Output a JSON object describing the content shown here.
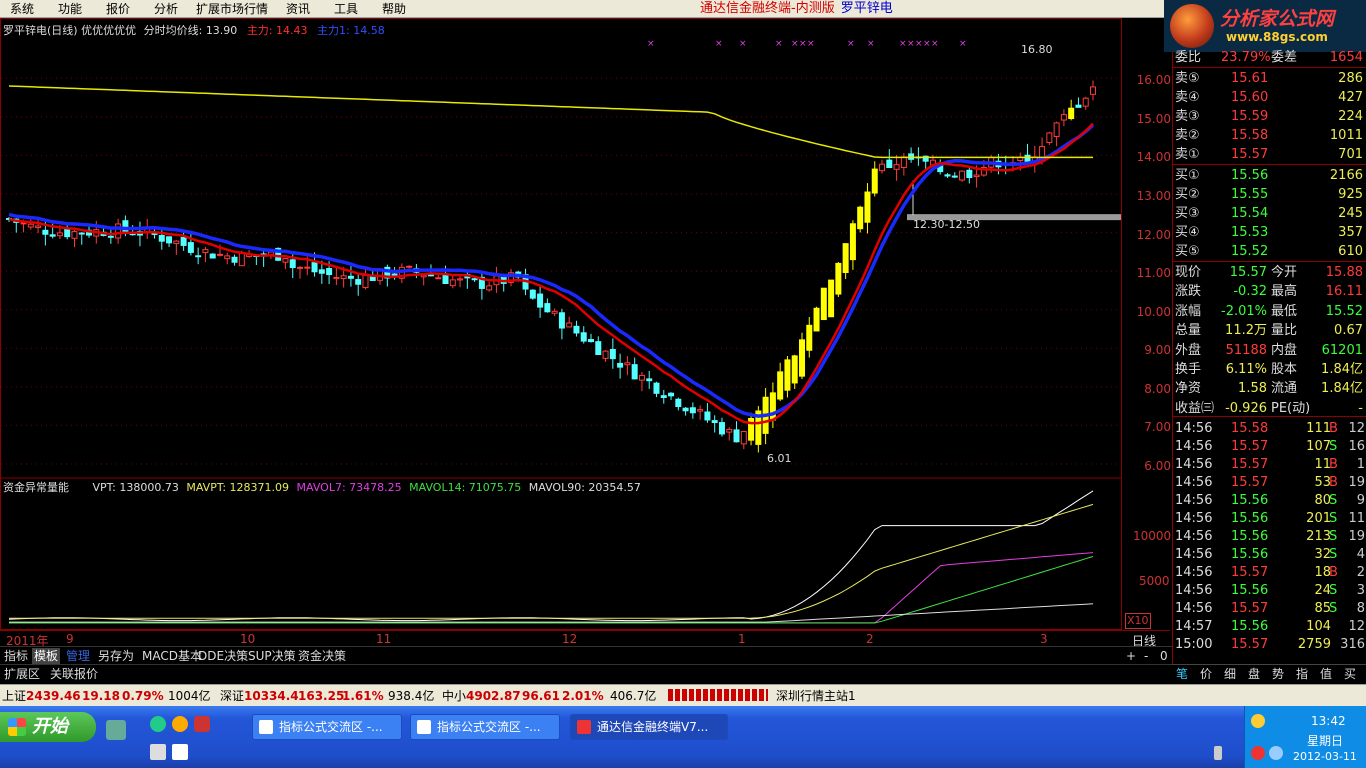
{
  "menu": [
    "系统",
    "功能",
    "报价",
    "分析",
    "扩展市场行情",
    "资讯",
    "工具",
    "帮助"
  ],
  "app_title": {
    "part1": "通达信金融终端-内测版",
    "part2": "罗平锌电"
  },
  "logo": {
    "name": "分析家公式网",
    "url": "www.88gs.com"
  },
  "chart_header": {
    "stock": "罗平锌电(日线)",
    "tags": "优优优优优",
    "avg_label": "分时均价线:",
    "avg_value": "13.90",
    "main1": "主力: 14.43",
    "main2": "主力1: 14.58"
  },
  "price_labels": {
    "high": "16.80",
    "low": "6.01",
    "band": "12.30-12.50"
  },
  "y_labels": [
    "16.00",
    "15.00",
    "14.00",
    "13.00",
    "12.00",
    "11.00",
    "10.00",
    "9.00",
    "8.00",
    "7.00",
    "6.00"
  ],
  "indicator": {
    "name": "资金异常量能",
    "vpt": "VPT: 138000.73",
    "mavpt": "MAVPT: 128371.09",
    "mavol7": "MAVOL7: 73478.25",
    "mavol14": "MAVOL14: 71075.75",
    "mavol90": "MAVOL90: 20354.57",
    "y1": "10000",
    "y2": "5000",
    "scale": "X10"
  },
  "time_axis": [
    "2011年",
    "9",
    "10",
    "11",
    "12",
    "1",
    "2",
    "3"
  ],
  "period": "日线",
  "zoom": [
    "+",
    "-",
    "0"
  ],
  "tabs": [
    "指标",
    "模板",
    "管理",
    "另存为",
    "MACD基本",
    "DDE决策",
    "SUP决策",
    "资金决策"
  ],
  "tabs2": [
    "扩展区",
    "关联报价"
  ],
  "order_book": {
    "top": {
      "label": "委比",
      "value": "23.79%",
      "label2": "委差",
      "value2": "1654"
    },
    "asks": [
      {
        "label": "卖⑤",
        "price": "15.61",
        "vol": "286"
      },
      {
        "label": "卖④",
        "price": "15.60",
        "vol": "427"
      },
      {
        "label": "卖③",
        "price": "15.59",
        "vol": "224"
      },
      {
        "label": "卖②",
        "price": "15.58",
        "vol": "1011"
      },
      {
        "label": "卖①",
        "price": "15.57",
        "vol": "701"
      }
    ],
    "bids": [
      {
        "label": "买①",
        "price": "15.56",
        "vol": "2166"
      },
      {
        "label": "买②",
        "price": "15.55",
        "vol": "925"
      },
      {
        "label": "买③",
        "price": "15.54",
        "vol": "245"
      },
      {
        "label": "买④",
        "price": "15.53",
        "vol": "357"
      },
      {
        "label": "买⑤",
        "price": "15.52",
        "vol": "610"
      }
    ]
  },
  "quote": [
    {
      "l1": "现价",
      "v1": "15.57",
      "l2": "今开",
      "v2": "15.88"
    },
    {
      "l1": "涨跌",
      "v1": "-0.32",
      "l2": "最高",
      "v2": "16.11"
    },
    {
      "l1": "涨幅",
      "v1": "-2.01%",
      "l2": "最低",
      "v2": "15.52"
    },
    {
      "l1": "总量",
      "v1": "11.2万",
      "l2": "量比",
      "v2": "0.67"
    },
    {
      "l1": "外盘",
      "v1": "51188",
      "l2": "内盘",
      "v2": "61201"
    },
    {
      "l1": "换手",
      "v1": "6.11%",
      "l2": "股本",
      "v2": "1.84亿"
    },
    {
      "l1": "净资",
      "v1": "1.58",
      "l2": "流通",
      "v2": "1.84亿"
    },
    {
      "l1": "收益㈢",
      "v1": "-0.926",
      "l2": "PE(动)",
      "v2": "-"
    }
  ],
  "ticks": [
    {
      "t": "14:56",
      "p": "15.58",
      "v": "111",
      "bs": "B",
      "n": "12"
    },
    {
      "t": "14:56",
      "p": "15.57",
      "v": "107",
      "bs": "S",
      "n": "16"
    },
    {
      "t": "14:56",
      "p": "15.57",
      "v": "11",
      "bs": "B",
      "n": "1"
    },
    {
      "t": "14:56",
      "p": "15.57",
      "v": "53",
      "bs": "B",
      "n": "19"
    },
    {
      "t": "14:56",
      "p": "15.56",
      "v": "80",
      "bs": "S",
      "n": "9"
    },
    {
      "t": "14:56",
      "p": "15.56",
      "v": "201",
      "bs": "S",
      "n": "11"
    },
    {
      "t": "14:56",
      "p": "15.56",
      "v": "213",
      "bs": "S",
      "n": "19"
    },
    {
      "t": "14:56",
      "p": "15.56",
      "v": "32",
      "bs": "S",
      "n": "4"
    },
    {
      "t": "14:56",
      "p": "15.57",
      "v": "18",
      "bs": "B",
      "n": "2"
    },
    {
      "t": "14:56",
      "p": "15.56",
      "v": "24",
      "bs": "S",
      "n": "3"
    },
    {
      "t": "14:56",
      "p": "15.57",
      "v": "85",
      "bs": "S",
      "n": "8"
    },
    {
      "t": "14:57",
      "p": "15.56",
      "v": "104",
      "bs": "",
      "n": "12"
    },
    {
      "t": "15:00",
      "p": "15.57",
      "v": "2759",
      "bs": "",
      "n": "316"
    }
  ],
  "right_tabs": [
    "笔",
    "价",
    "细",
    "盘",
    "势",
    "指",
    "值",
    "买"
  ],
  "status": {
    "sh": {
      "label": "上证",
      "val": "2439.46",
      "chg": "19.18",
      "pct": "0.79%",
      "amt": "1004亿"
    },
    "sz": {
      "label": "深证",
      "val": "10334.4",
      "chg": "163.25",
      "pct": "1.61%",
      "amt": "938.4亿"
    },
    "zx": {
      "label": "中小",
      "val": "4902.87",
      "chg": "96.61",
      "pct": "2.01%",
      "amt": "406.7亿"
    },
    "server": "深圳行情主站1"
  },
  "taskbar": {
    "start": "开始",
    "tasks": [
      "指标公式交流区 -...",
      "指标公式交流区 -...",
      "通达信金融终端V7..."
    ],
    "clock": "13:42",
    "day": "星期日",
    "date": "2012-03-11"
  },
  "colors": {
    "up": "#ff3b3b",
    "down": "#54ffff",
    "ma_red": "#e00000",
    "ma_blue": "#1a2aff",
    "yellow": "#e8e800"
  },
  "chart_data": {
    "type": "candlestick",
    "price_axis": {
      "min": 6.0,
      "max": 16.5,
      "ticks": [
        16,
        15,
        14,
        13,
        12,
        11,
        10,
        9,
        8,
        7,
        6
      ]
    },
    "period": "daily",
    "months": [
      "2011年",
      "9",
      "10",
      "11",
      "12",
      "1",
      "2",
      "3"
    ],
    "high_label": 16.8,
    "low_label": 6.01,
    "annotation": "12.30-12.50",
    "series": [
      {
        "name": "主力",
        "last": 14.43
      },
      {
        "name": "主力1",
        "last": 14.58
      },
      {
        "name": "分时均价线",
        "last": 13.9
      }
    ]
  }
}
